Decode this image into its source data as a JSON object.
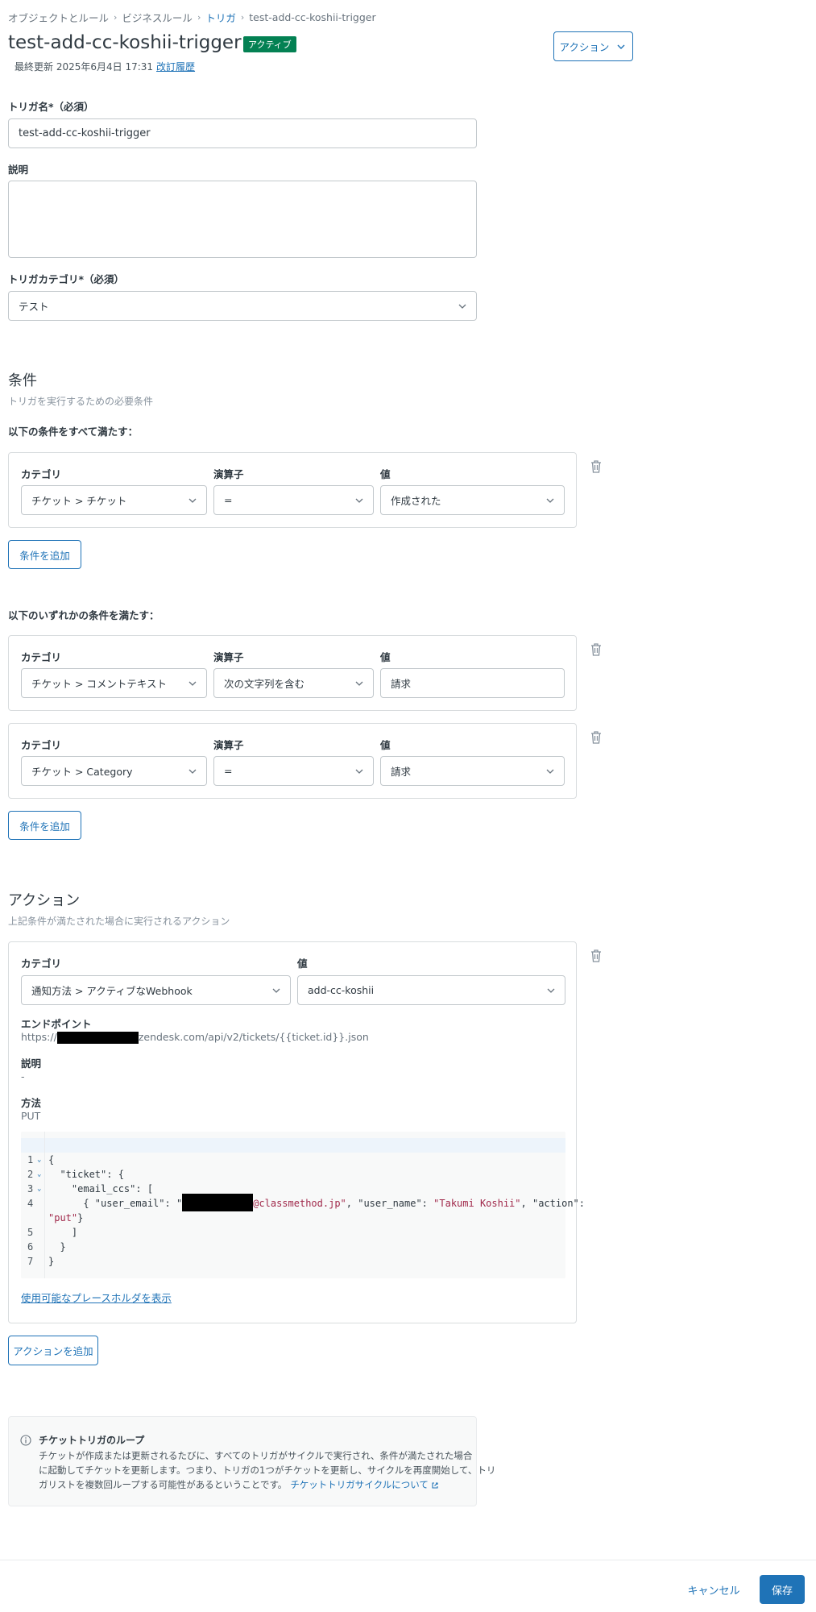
{
  "breadcrumb": {
    "items": [
      "オブジェクトとルール",
      "ビジネスルール",
      "トリガ",
      "test-add-cc-koshii-trigger"
    ]
  },
  "header": {
    "title": "test-add-cc-koshii-trigger",
    "status_badge": "アクティブ",
    "last_updated": "最終更新 2025年6月4日 17:31",
    "revision_link": "改訂履歴",
    "action_button": "アクション"
  },
  "form": {
    "name_label": "トリガ名*（必須）",
    "name_value": "test-add-cc-koshii-trigger",
    "description_label": "説明",
    "description_value": "",
    "category_label": "トリガカテゴリ*（必須）",
    "category_value": "テスト"
  },
  "conditions": {
    "title": "条件",
    "subtitle": "トリガを実行するための必要条件",
    "all_title": "以下の条件をすべて満たす：",
    "any_title": "以下のいずれかの条件を満たす：",
    "col_category": "カテゴリ",
    "col_operator": "演算子",
    "col_value": "値",
    "add_button": "条件を追加",
    "all": [
      {
        "category": "チケット > チケット",
        "operator": "=",
        "value": "作成された"
      }
    ],
    "any": [
      {
        "category": "チケット > コメントテキスト",
        "operator": "次の文字列を含む",
        "value": "請求"
      },
      {
        "category": "チケット > Category",
        "operator": "=",
        "value": "請求"
      }
    ]
  },
  "actions": {
    "title": "アクション",
    "subtitle": "上記条件が満たされた場合に実行されるアクション",
    "col_category": "カテゴリ",
    "col_value": "値",
    "category_value": "通知方法 > アクティブなWebhook",
    "value_value": "add-cc-koshii",
    "endpoint_label": "エンドポイント",
    "endpoint_prefix": "https://",
    "endpoint_suffix": "zendesk.com/api/v2/tickets/{{ticket.id}}.json",
    "description_label": "説明",
    "description_value": "-",
    "method_label": "方法",
    "method_value": "PUT",
    "code": {
      "line_numbers": [
        "1",
        "2",
        "3",
        "4",
        "",
        "5",
        "6",
        "7"
      ],
      "l1": "{",
      "l2": "  \"ticket\": {",
      "l3": "    \"email_ccs\": [",
      "l4_a": "      { \"user_email\": \"",
      "l4_b": "@classmethod.jp\"",
      "l4_c": ", \"user_name\": ",
      "l4_d": "\"Takumi Koshii\"",
      "l4_e": ", \"action\":",
      "l4_f": "\"put\"",
      "l4_g": "}",
      "l5": "    ]",
      "l6": "  }",
      "l7": "}"
    },
    "placeholders_link": "使用可能なプレースホルダを表示",
    "add_button": "アクションを追加"
  },
  "info": {
    "title": "チケットトリガのループ",
    "body_1": "チケットが作成または更新されるたびに、すべてのトリガがサイクルで実行され、条件が満たされた場合",
    "body_2": "に起動してチケットを更新します。つまり、トリガの1つがチケットを更新し、サイクルを再度開始して、トリ",
    "body_3": "ガリストを複数回ループする可能性があるということです。",
    "link": "チケットトリガサイクルについて"
  },
  "footer": {
    "cancel": "キャンセル",
    "save": "保存"
  }
}
